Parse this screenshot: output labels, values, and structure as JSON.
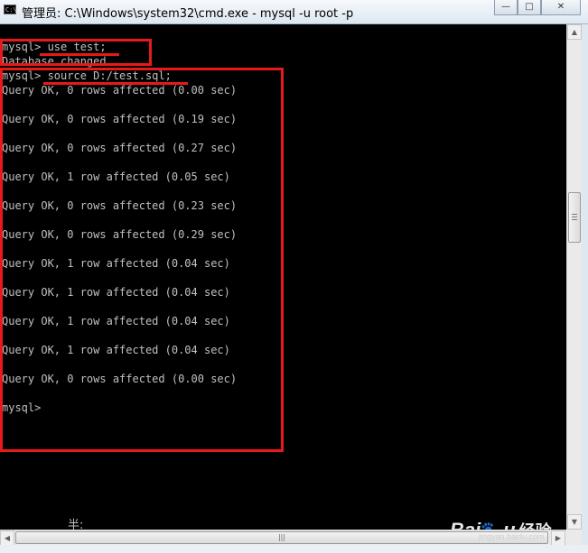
{
  "window": {
    "title": "管理员: C:\\Windows\\system32\\cmd.exe - mysql  -u root  -p",
    "icon_label": "C:\\",
    "buttons": {
      "minimize": "—",
      "maximize": "□",
      "close": "✕"
    }
  },
  "console": {
    "lines": [
      "mysql> use test;",
      "Database changed",
      "mysql> source D:/test.sql;",
      "Query OK, 0 rows affected (0.00 sec)",
      "",
      "Query OK, 0 rows affected (0.19 sec)",
      "",
      "Query OK, 0 rows affected (0.27 sec)",
      "",
      "Query OK, 1 row affected (0.05 sec)",
      "",
      "Query OK, 0 rows affected (0.23 sec)",
      "",
      "Query OK, 0 rows affected (0.29 sec)",
      "",
      "Query OK, 1 row affected (0.04 sec)",
      "",
      "Query OK, 1 row affected (0.04 sec)",
      "",
      "Query OK, 1 row affected (0.04 sec)",
      "",
      "Query OK, 1 row affected (0.04 sec)",
      "",
      "Query OK, 0 rows affected (0.00 sec)",
      "",
      "mysql>"
    ],
    "ime_indicator": "半:"
  },
  "scrollbars": {
    "up_arrow": "▲",
    "down_arrow": "▼",
    "left_arrow": "◀",
    "right_arrow": "▶",
    "h_grip": "|||"
  },
  "watermark": {
    "brand": "Bai",
    "paw": "🐾",
    "brand_end": "u",
    "suffix": "经验",
    "url": "jingyan.baidu.com"
  },
  "colors": {
    "console_bg": "#000000",
    "console_text": "#c0c0c0",
    "highlight": "#e8191b"
  }
}
